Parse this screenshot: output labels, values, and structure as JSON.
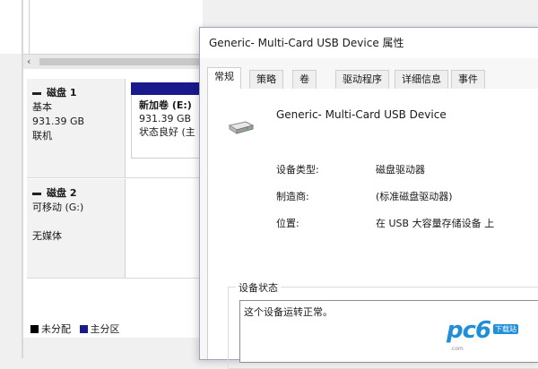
{
  "disk_management": {
    "disks": [
      {
        "name": "磁盘 1",
        "type": "基本",
        "size": "931.39 GB",
        "state": "联机",
        "partition": {
          "name": "新加卷 (E:)",
          "size": "931.39 GB",
          "status": "状态良好 (主"
        }
      },
      {
        "name": "磁盘 2",
        "type": "可移动 (G:)",
        "media": "无媒体"
      }
    ],
    "legend": [
      {
        "label": "未分配",
        "color": "#000000"
      },
      {
        "label": "主分区",
        "color": "#1a1a8c"
      }
    ]
  },
  "dialog": {
    "title": "Generic- Multi-Card USB Device 属性",
    "tabs": [
      "常规",
      "策略",
      "卷",
      "驱动程序",
      "详细信息",
      "事件"
    ],
    "active_tab": 0,
    "device_name": "Generic- Multi-Card USB Device",
    "device_icon": "usb-drive-icon",
    "properties": [
      {
        "label": "设备类型:",
        "value": "磁盘驱动器"
      },
      {
        "label": "制造商:",
        "value": "(标准磁盘驱动器)"
      },
      {
        "label": "位置:",
        "value": "在 USB 大容量存储设备 上"
      }
    ],
    "status_group_label": "设备状态",
    "status_text": "这个设备运转正常。"
  },
  "watermark": {
    "logo": "pc6",
    "sub": "下载站",
    "line": ".com"
  }
}
